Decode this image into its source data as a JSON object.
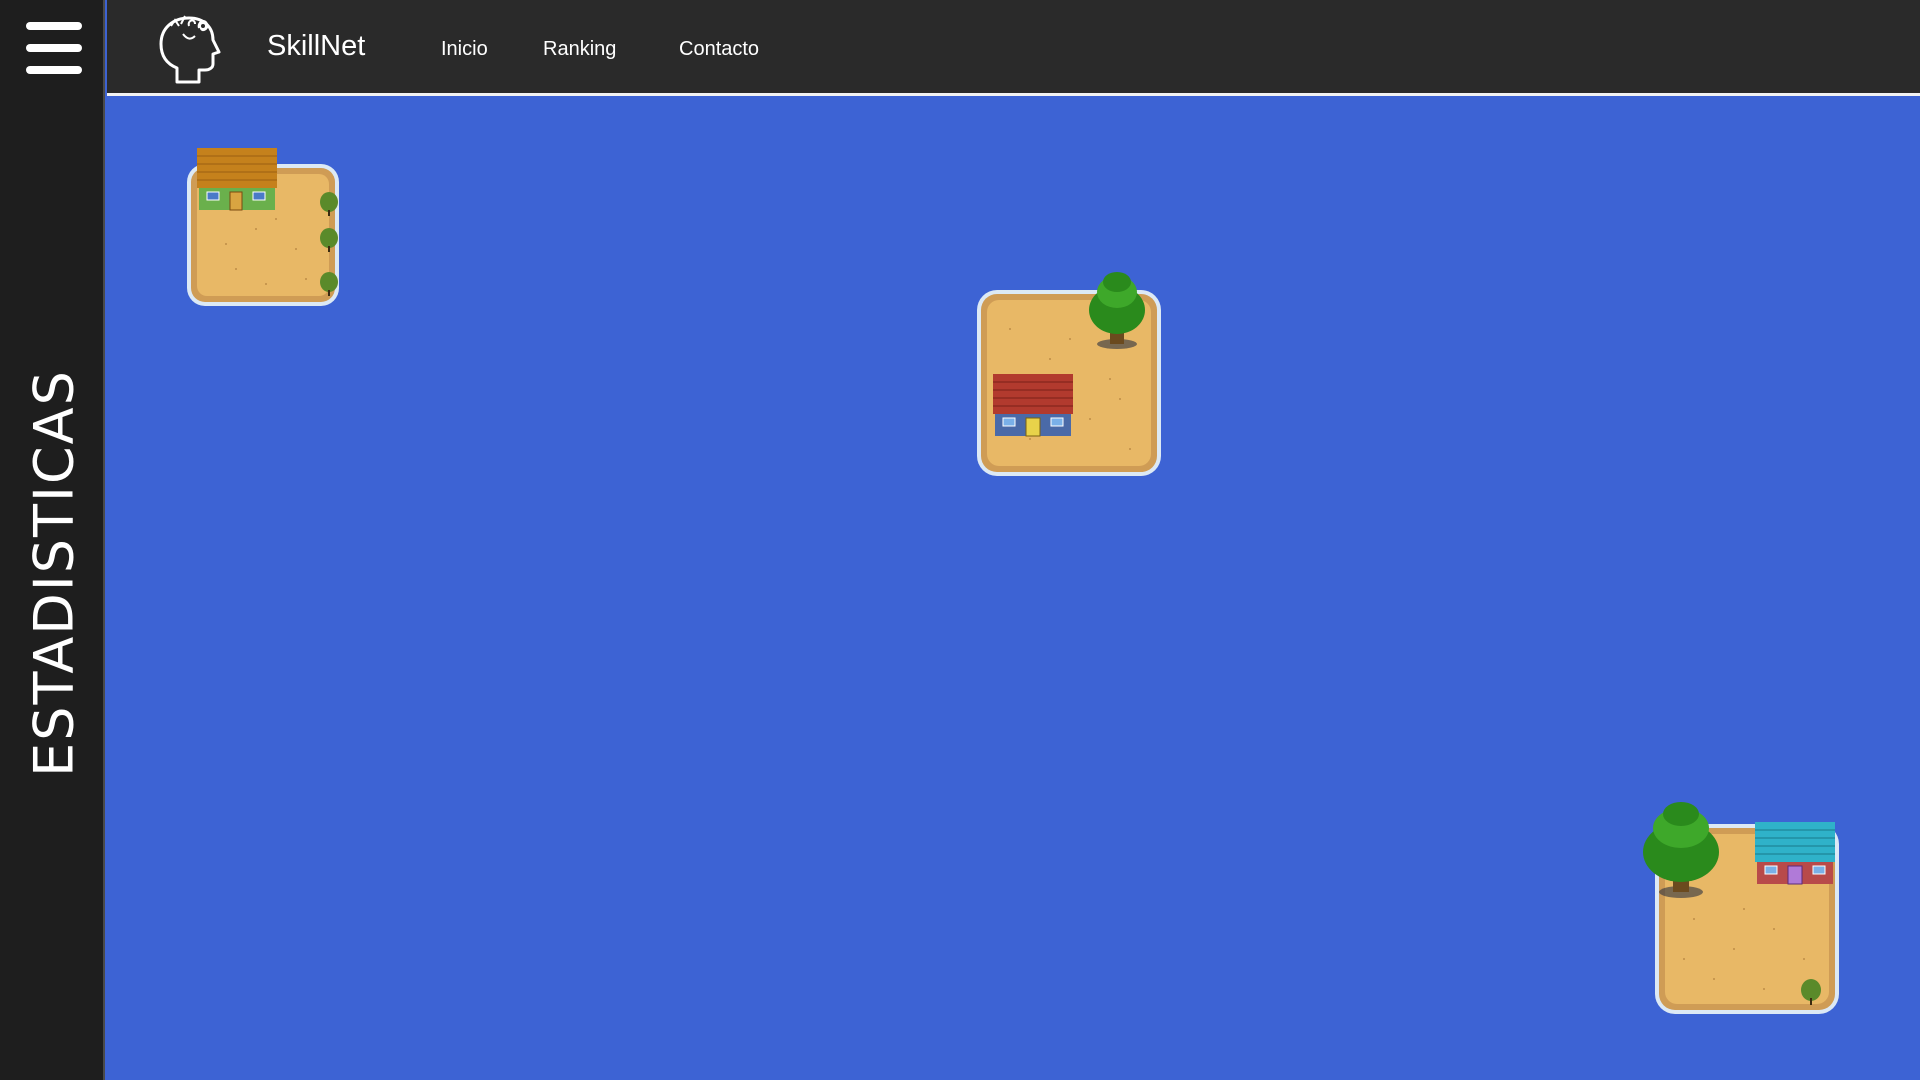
{
  "app": {
    "brand": "SkillNet"
  },
  "nav": {
    "inicio": "Inicio",
    "ranking": "Ranking",
    "contacto": "Contacto"
  },
  "sidebar": {
    "stats_label": "ESTADISTICAS"
  },
  "colors": {
    "water": "#3d63d4",
    "sand": "#e8b866",
    "sand_dark": "#cf9c55",
    "foam": "#dce9f5",
    "sidebar_bg": "#1e1e1e",
    "header_bg": "#2a2a2a",
    "roof_orange": "#c5811c",
    "roof_red": "#b23a2e",
    "roof_cyan": "#2fb2c9",
    "tree_green": "#2a8a1c"
  },
  "icons": {
    "menu": "hamburger-menu-icon",
    "logo": "brain-head-logo-icon"
  }
}
